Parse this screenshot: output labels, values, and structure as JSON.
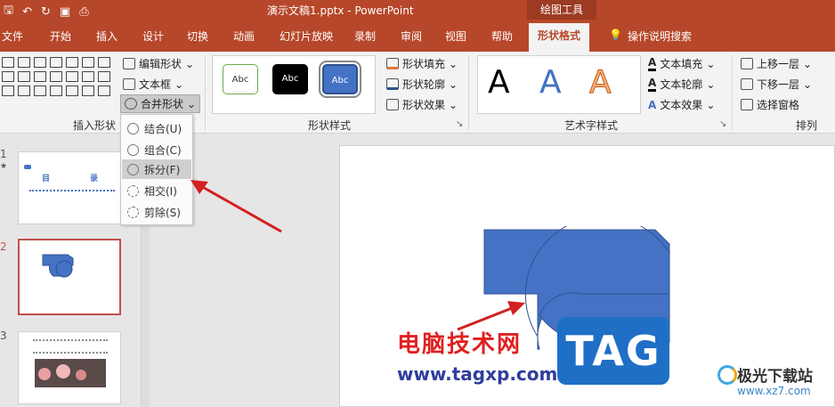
{
  "titlebar": {
    "doc_title": "演示文稿1.pptx  -  PowerPoint",
    "context_tab": "绘图工具"
  },
  "tabs": [
    "文件",
    "开始",
    "插入",
    "设计",
    "切换",
    "动画",
    "幻灯片放映",
    "录制",
    "审阅",
    "视图",
    "帮助",
    "形状格式"
  ],
  "tellme": "操作说明搜索",
  "ribbon": {
    "insert_shapes": {
      "edit_shape": "编辑形状",
      "textbox": "文本框",
      "merge_shapes": "合并形状",
      "group_label": "插入形状"
    },
    "shape_styles": {
      "samples": [
        "Abc",
        "Abc",
        "Abc"
      ],
      "fill": "形状填充",
      "outline": "形状轮廓",
      "effects": "形状效果",
      "group_label": "形状样式"
    },
    "wordart": {
      "samples": [
        "A",
        "A",
        "A"
      ],
      "text_fill": "文本填充",
      "text_outline": "文本轮廓",
      "text_effects": "文本效果",
      "group_label": "艺术字样式"
    },
    "arrange": {
      "bring_forward": "上移一层",
      "send_backward": "下移一层",
      "selection_pane": "选择窗格",
      "group_label": "排列"
    }
  },
  "merge_menu": {
    "items": [
      {
        "label": "结合(U)"
      },
      {
        "label": "组合(C)"
      },
      {
        "label": "拆分(F)"
      },
      {
        "label": "相交(I)"
      },
      {
        "label": "剪除(S)"
      }
    ]
  },
  "thumbnails": {
    "nums": [
      "1",
      "2",
      "3"
    ],
    "slide1_text": [
      "目",
      "录"
    ]
  },
  "watermarks": {
    "cn": "电脑技术网",
    "url": "www.tagxp.com",
    "tag": "TAG",
    "site_cn": "极光下载站",
    "site_url": "www.xz7.com"
  },
  "colors": {
    "accent": "#b7472a",
    "shape_fill": "#4472c4",
    "arrow_red": "#d42020"
  }
}
